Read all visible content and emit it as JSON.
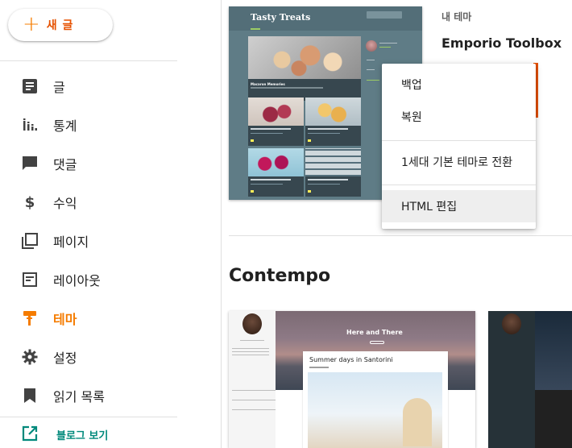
{
  "sidebar": {
    "new_post_label": "새 글",
    "items": [
      {
        "label": "글",
        "icon": "posts-icon"
      },
      {
        "label": "통계",
        "icon": "stats-icon"
      },
      {
        "label": "댓글",
        "icon": "comments-icon"
      },
      {
        "label": "수익",
        "icon": "dollar-icon"
      },
      {
        "label": "페이지",
        "icon": "pages-icon"
      },
      {
        "label": "레이아웃",
        "icon": "layout-icon"
      },
      {
        "label": "테마",
        "icon": "paint-roller-icon",
        "active": true
      },
      {
        "label": "설정",
        "icon": "gear-icon"
      },
      {
        "label": "읽기 목록",
        "icon": "bookmark-icon"
      }
    ],
    "view_blog_label": "블로그 보기"
  },
  "theme": {
    "section_label": "내 테마",
    "current_name": "Emporio Toolbox",
    "preview": {
      "blog_title": "Tasty Treats",
      "hero_post_title": "Macaron Memories"
    }
  },
  "menu": {
    "items": [
      "백업",
      "복원",
      "1세대 기본 테마로 전환",
      "HTML 편집"
    ],
    "highlighted_index": 3
  },
  "gallery": {
    "section_title": "Contempo",
    "preview": {
      "hero_title": "Here and There",
      "card_title": "Summer days in Santorini"
    }
  },
  "colors": {
    "accent": "#f57c00",
    "link": "#00897b",
    "theme_bg": "#5f7c86"
  }
}
